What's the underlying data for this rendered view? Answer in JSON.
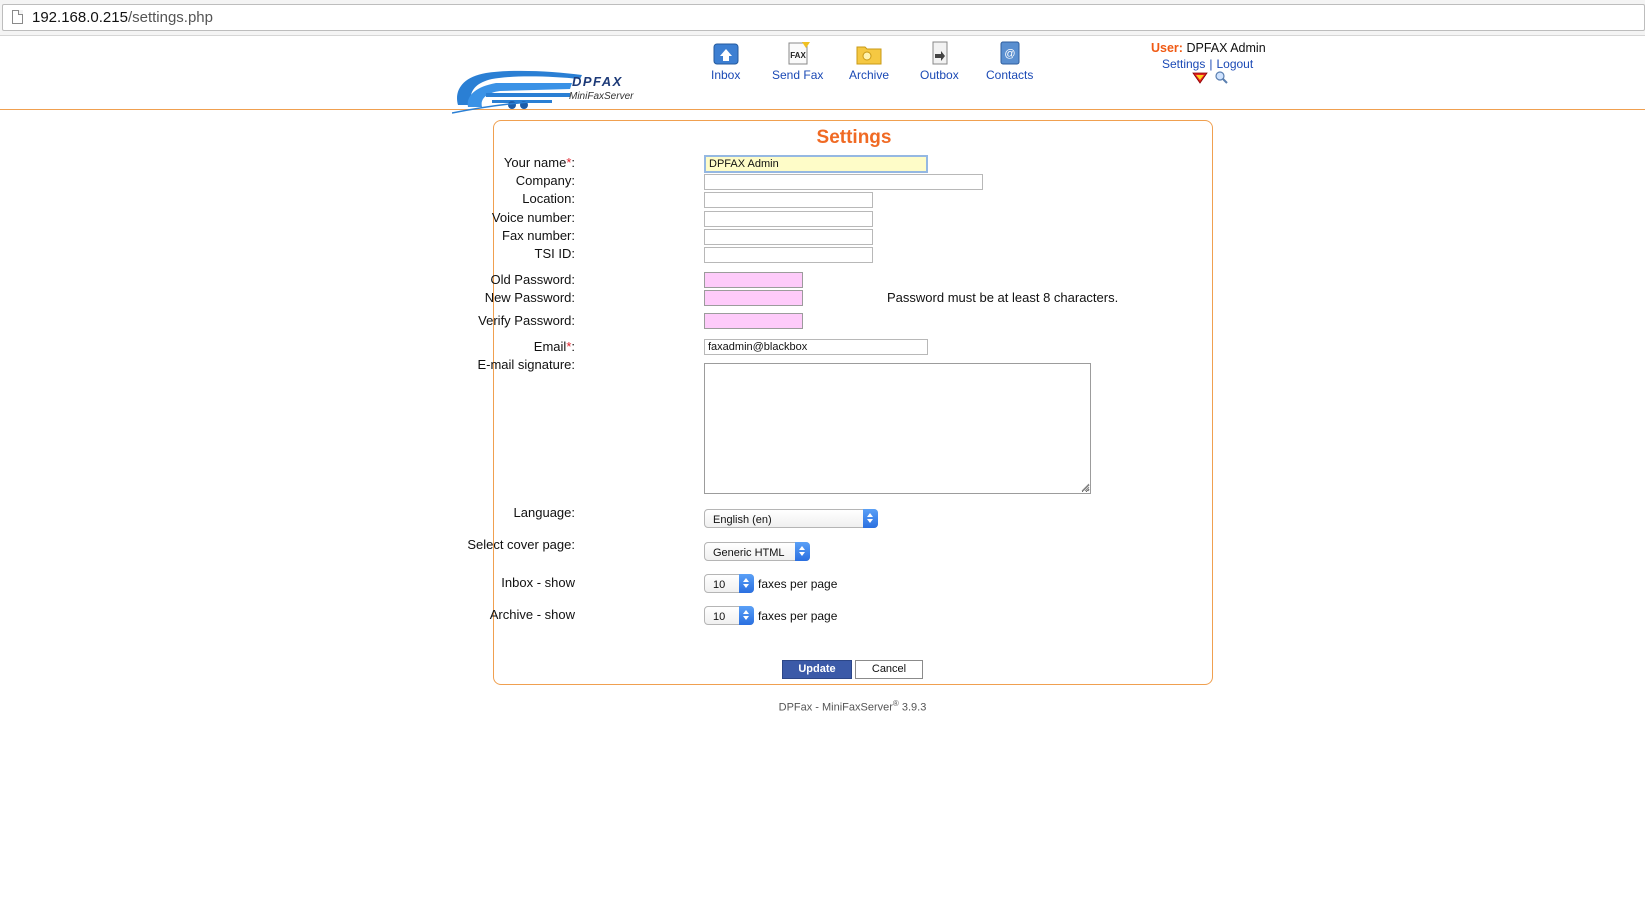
{
  "browser": {
    "url_host": "192.168.0.215",
    "url_path": "/settings.php"
  },
  "header": {
    "logo_text": "DPFAX",
    "logo_subtext": "MiniFaxServer",
    "nav": [
      {
        "label": "Inbox",
        "icon": "inbox-icon"
      },
      {
        "label": "Send Fax",
        "icon": "send-fax-icon"
      },
      {
        "label": "Archive",
        "icon": "archive-folder-icon"
      },
      {
        "label": "Outbox",
        "icon": "outbox-icon"
      },
      {
        "label": "Contacts",
        "icon": "contacts-icon"
      }
    ],
    "user_label": "User:",
    "user_name": "DPFAX Admin",
    "settings_link": "Settings",
    "separator": "|",
    "logout_link": "Logout"
  },
  "settings": {
    "title": "Settings",
    "your_name_label": "Your name",
    "your_name_value": "DPFAX Admin",
    "company_label": "Company:",
    "company_value": "",
    "location_label": "Location:",
    "location_value": "",
    "voice_label": "Voice number:",
    "voice_value": "",
    "fax_label": "Fax number:",
    "fax_value": "",
    "tsi_label": "TSI ID:",
    "tsi_value": "",
    "old_password_label": "Old Password:",
    "new_password_label": "New Password:",
    "verify_password_label": "Verify Password:",
    "password_note": "Password must be at least 8 characters.",
    "email_label": "Email",
    "email_value": "faxadmin@blackbox",
    "signature_label": "E-mail signature:",
    "signature_value": "",
    "language_label": "Language:",
    "language_value": "English (en)",
    "cover_label": "Select cover page:",
    "cover_value": "Generic HTML",
    "inbox_show_label": "Inbox - show",
    "inbox_show_value": "10",
    "archive_show_label": "Archive - show",
    "archive_show_value": "10",
    "per_page_suffix": "faxes per page",
    "required_mark": "*",
    "colon": ":",
    "update_button": "Update",
    "cancel_button": "Cancel"
  },
  "footer": {
    "text": "DPFax - MiniFaxServer",
    "reg": "®",
    "version": " 3.9.3"
  },
  "colors": {
    "accent_orange": "#f06a24",
    "link_blue": "#1a49b5",
    "update_button_bg": "#3b5aa8",
    "password_field_bg": "#fecbfa",
    "focused_field_bg": "#fefcc8"
  }
}
